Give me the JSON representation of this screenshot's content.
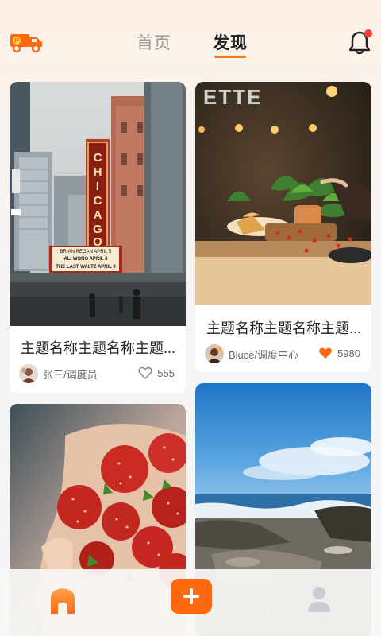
{
  "header": {
    "tabs": [
      {
        "label": "首页",
        "active": false
      },
      {
        "label": "发现",
        "active": true
      }
    ],
    "notification_badge": true,
    "accent": "#ff7a1a"
  },
  "feed": {
    "cards": [
      {
        "title": "主题名称主题名称主题...",
        "author": "张三/调度员",
        "likes": "555",
        "liked": false,
        "image": "city-street-chicago-theatre",
        "sign_text": "CHICAGO",
        "marquee": [
          "BRIAN REGAN APRIL 5",
          "ALI WONG APRIL 6",
          "THE LAST WALTZ APRIL 9"
        ]
      },
      {
        "title": "主题名称主题名称主题...",
        "author": "Bluce/调度中心",
        "likes": "5980",
        "liked": true,
        "image": "restaurant-plants-table",
        "sign_text": "ETTE"
      },
      {
        "image": "hand-holding-strawberries"
      },
      {
        "image": "ocean-rocky-shore"
      }
    ]
  },
  "bottom_nav": {
    "items": [
      "home-icon",
      "add-icon",
      "user-icon"
    ],
    "active": "home-icon"
  },
  "colors": {
    "brand": "#ff6a10",
    "badge": "#ff3b30"
  }
}
